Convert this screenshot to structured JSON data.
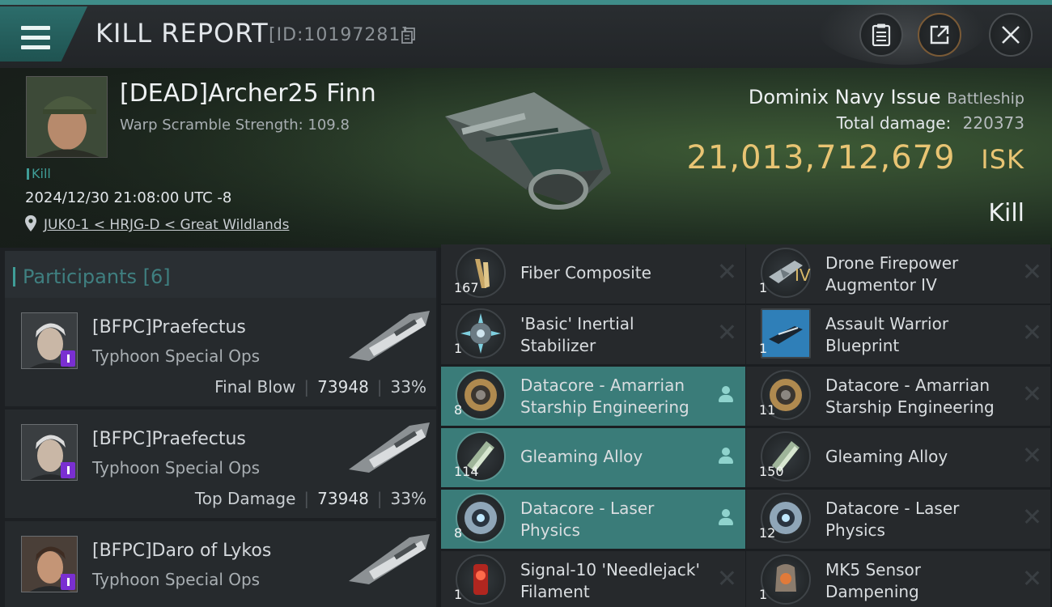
{
  "topbar": {
    "title": "KILL REPORT",
    "report_id": "[ID:10197281]"
  },
  "victim": {
    "name": "[DEAD]Archer25 Finn",
    "warp_scramble": "Warp Scramble Strength: 109.8",
    "kill_tag": "Kill",
    "datetime": "2024/12/30 21:08:00 UTC -8",
    "location": "JUK0-1 < HRJG-D < Great Wildlands",
    "ship_name": "Dominix Navy Issue",
    "ship_class": "Battleship",
    "total_damage_label": "Total damage:",
    "total_damage_value": "220373",
    "isk_value": "21,013,712,679",
    "isk_unit": "ISK",
    "result_label": "Kill"
  },
  "participants": {
    "title": "Participants [6]",
    "list": [
      {
        "name": "[BFPC]Praefectus",
        "ship": "Typhoon Special Ops",
        "role": "Final Blow",
        "damage": "73948",
        "percent": "33%"
      },
      {
        "name": "[BFPC]Praefectus",
        "ship": "Typhoon Special Ops",
        "role": "Top Damage",
        "damage": "73948",
        "percent": "33%"
      },
      {
        "name": "[BFPC]Daro of Lykos",
        "ship": "Typhoon Special Ops",
        "role": "",
        "damage": "",
        "percent": ""
      }
    ]
  },
  "items": {
    "left": [
      {
        "name": "Fiber Composite",
        "qty": "167",
        "icon": "fiber-composite-icon",
        "highlight": false
      },
      {
        "name": "'Basic' Inertial Stabilizer",
        "qty": "1",
        "icon": "inertial-stabilizer-icon",
        "highlight": false
      },
      {
        "name": "Datacore - Amarrian Starship Engineering",
        "qty": "8",
        "icon": "datacore-icon",
        "highlight": true
      },
      {
        "name": "Gleaming Alloy",
        "qty": "114",
        "icon": "gleaming-alloy-icon",
        "highlight": true
      },
      {
        "name": "Datacore - Laser Physics",
        "qty": "8",
        "icon": "laser-datacore-icon",
        "highlight": true
      },
      {
        "name": "Signal-10 'Needlejack' Filament",
        "qty": "1",
        "icon": "filament-icon",
        "highlight": false
      }
    ],
    "right": [
      {
        "name": "Drone Firepower Augmentor IV",
        "qty": "1",
        "icon": "drone-augmentor-icon",
        "meta": "IV",
        "highlight": false
      },
      {
        "name": "Assault Warrior Blueprint",
        "qty": "1",
        "icon": "blueprint-icon",
        "highlight": false
      },
      {
        "name": "Datacore - Amarrian Starship Engineering",
        "qty": "11",
        "icon": "datacore-icon",
        "highlight": false
      },
      {
        "name": "Gleaming Alloy",
        "qty": "150",
        "icon": "gleaming-alloy-icon",
        "highlight": false
      },
      {
        "name": "Datacore - Laser Physics",
        "qty": "12",
        "icon": "laser-datacore-icon",
        "highlight": false
      },
      {
        "name": "MK5 Sensor Dampening",
        "qty": "1",
        "icon": "sensor-dampening-icon",
        "highlight": false
      }
    ]
  },
  "colors": {
    "accent": "#3f8d89",
    "highlight_row": "#3a7c79",
    "isk_gold": "#e8c473",
    "corp_badge": "#7a2fd1"
  }
}
